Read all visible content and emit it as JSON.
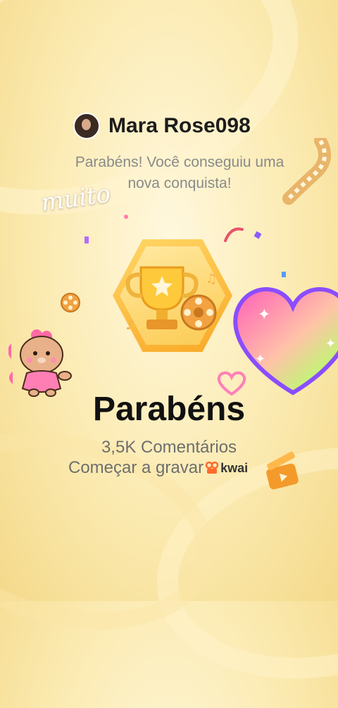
{
  "header": {
    "username": "Mara Rose098",
    "subtitle_line1": "Parabéns! Você conseguiu uma",
    "subtitle_line2": "nova conquista!"
  },
  "sticker": {
    "text": "muito"
  },
  "main": {
    "headline": "Parabéns",
    "comments": "3,5K Comentários",
    "record_cta": "Começar a gravar",
    "brand": "kwai"
  },
  "colors": {
    "accent_gold": "#f9a826",
    "heart_pink": "#ff6bc1",
    "heart_purple": "#8a4dff",
    "text_dark": "#111111",
    "text_muted": "#6e6e6e"
  },
  "icons": [
    "trophy-icon",
    "film-reel-icon",
    "heart-icon",
    "bear-sticker-icon",
    "film-strip-icon",
    "clapperboard-icon",
    "kwai-logo-icon"
  ]
}
